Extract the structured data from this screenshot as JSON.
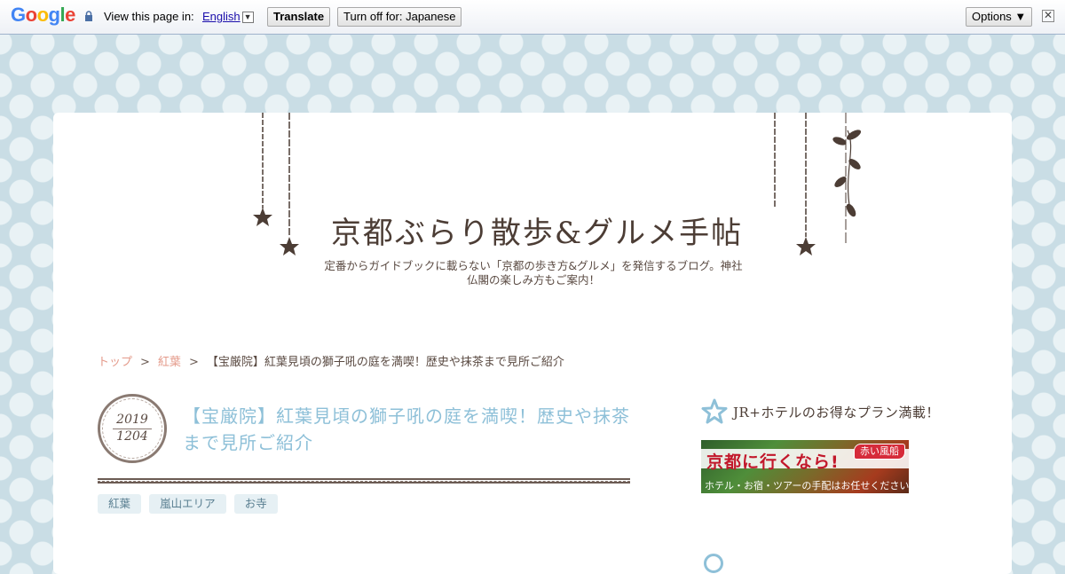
{
  "translate_bar": {
    "logo": "Google",
    "logo_colors": [
      "#4285f4",
      "#ea4335",
      "#fbbc05",
      "#4285f4",
      "#34a853",
      "#ea4335"
    ],
    "view_text": "View this page in:",
    "language": "English",
    "language_arrow": "▼",
    "translate_button": "Translate",
    "turn_off_button": "Turn off for: Japanese",
    "options_button": "Options ▼",
    "close_icon": "✕"
  },
  "site": {
    "title": "京都ぶらり散歩&グルメ手帖",
    "description": "定番からガイドブックに載らない「京都の歩き方&グルメ」を発信するブログ。神社仏閣の楽しみ方もご案内！"
  },
  "breadcrumb": {
    "items": [
      "トップ",
      "紅葉",
      "【宝厳院】紅葉見頃の獅子吼の庭を満喫！歴史や抹茶まで見所ご紹介"
    ],
    "separator": ">"
  },
  "post": {
    "date_year": "2019",
    "date_md": "1204",
    "title": "【宝厳院】紅葉見頃の獅子吼の庭を満喫！歴史や抹茶まで見所ご紹介",
    "tags": [
      "紅葉",
      "嵐山エリア",
      "お寺"
    ]
  },
  "sidebar": {
    "heading": "JR+ホテルのお得なプラン満載！",
    "banner": {
      "main": "京都に行くなら!",
      "badge": "赤い風船",
      "sub": "ホテル・お宿・ツアーの手配はお任せください"
    }
  },
  "colors": {
    "accent_title": "#8ec0d8",
    "link": "#e49a8a",
    "text": "#4c3d35",
    "background": "#c9dde5"
  }
}
